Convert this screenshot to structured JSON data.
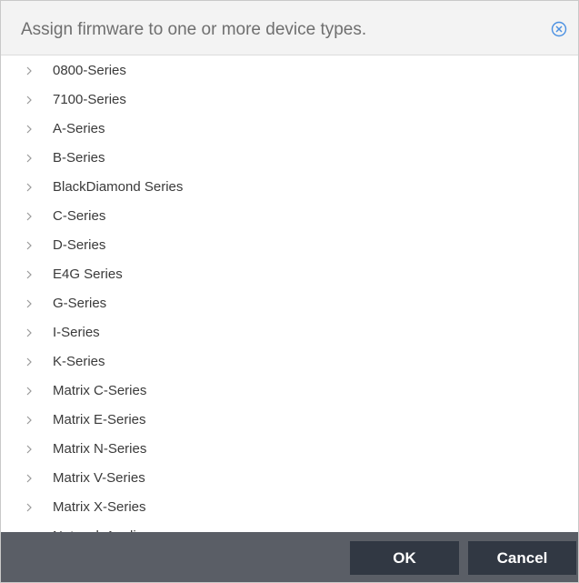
{
  "dialog": {
    "title": "Assign firmware to one or more device types.",
    "close_icon": "close-circle-icon"
  },
  "tree": {
    "expand_icon": "chevron-right-icon",
    "items": [
      {
        "label": "0800-Series"
      },
      {
        "label": "7100-Series"
      },
      {
        "label": "A-Series"
      },
      {
        "label": "B-Series"
      },
      {
        "label": "BlackDiamond Series"
      },
      {
        "label": "C-Series"
      },
      {
        "label": "D-Series"
      },
      {
        "label": "E4G Series"
      },
      {
        "label": "G-Series"
      },
      {
        "label": "I-Series"
      },
      {
        "label": "K-Series"
      },
      {
        "label": "Matrix C-Series"
      },
      {
        "label": "Matrix E-Series"
      },
      {
        "label": "Matrix N-Series"
      },
      {
        "label": "Matrix V-Series"
      },
      {
        "label": "Matrix X-Series"
      },
      {
        "label": "Network Appliance"
      }
    ]
  },
  "footer": {
    "ok_label": "OK",
    "cancel_label": "Cancel"
  },
  "colors": {
    "header_bg": "#f3f3f3",
    "footer_bg": "#5a5e66",
    "button_bg": "#313843",
    "close_icon": "#4a90e2"
  }
}
